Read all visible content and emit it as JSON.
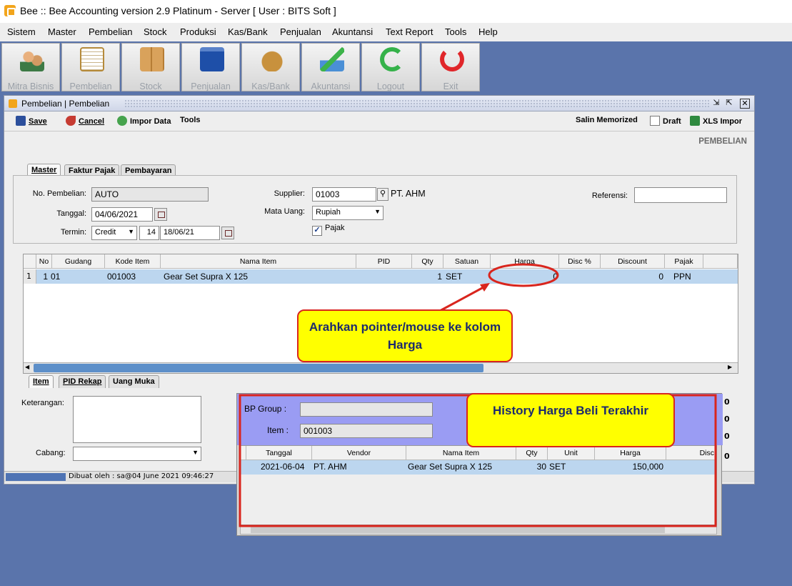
{
  "window_title": "Bee :: Bee Accounting version 2.9 Platinum - Server  [ User : BITS Soft ]",
  "menu": [
    "Sistem",
    "Master",
    "Pembelian",
    "Stock",
    "Produksi",
    "Kas/Bank",
    "Penjualan",
    "Akuntansi",
    "Text Report",
    "Tools",
    "Help"
  ],
  "toolbar": [
    {
      "label": "Mitra Bisnis",
      "icon": "people-icon"
    },
    {
      "label": "Pembelian",
      "icon": "invoice-icon"
    },
    {
      "label": "Stock",
      "icon": "boxes-icon"
    },
    {
      "label": "Penjualan",
      "icon": "shopping-bag-icon"
    },
    {
      "label": "Kas/Bank",
      "icon": "money-bag-icon"
    },
    {
      "label": "Akuntansi",
      "icon": "chart-up-icon"
    },
    {
      "label": "Logout",
      "icon": "logout-arrow-icon"
    },
    {
      "label": "Exit",
      "icon": "power-icon"
    }
  ],
  "inner_window": {
    "title": "Pembelian | Pembelian"
  },
  "form_toolbar": {
    "save": "Save",
    "cancel": "Cancel",
    "import": "Impor Data",
    "tools": "Tools",
    "salin": "Salin Memorized",
    "draft": "Draft",
    "xls": "XLS Impor"
  },
  "section_label": "PEMBELIAN",
  "tabs_top": [
    "Master",
    "Faktur Pajak",
    "Pembayaran"
  ],
  "form": {
    "no_pembelian_label": "No. Pembelian:",
    "no_pembelian": "AUTO",
    "tanggal_label": "Tanggal:",
    "tanggal": "04/06/2021",
    "termin_label": "Termin:",
    "termin": "Credit",
    "termin_days": "14",
    "termin_date": "18/06/21",
    "supplier_label": "Supplier:",
    "supplier_code": "01003",
    "supplier_name": "PT. AHM",
    "mata_uang_label": "Mata Uang:",
    "mata_uang": "Rupiah",
    "pajak_label": "Pajak",
    "referensi_label": "Referensi:",
    "referensi": ""
  },
  "grid": {
    "headers": [
      "No",
      "Gudang",
      "Kode Item",
      "Nama Item",
      "PID",
      "Qty",
      "Satuan",
      "Harga",
      "Disc %",
      "Discount",
      "Pajak"
    ],
    "rows": [
      {
        "idx": "1",
        "no": "1",
        "gudang": "01",
        "kode": "001003",
        "nama": "Gear Set Supra X 125",
        "pid": "",
        "qty": "1",
        "satuan": "SET",
        "harga": "0",
        "disc": "",
        "discount": "0",
        "pajak": "PPN"
      }
    ]
  },
  "tabs_bottom": [
    "Item",
    "PID Rekap",
    "Uang Muka"
  ],
  "bottom": {
    "keterangan_label": "Keterangan:",
    "cabang_label": "Cabang:",
    "right_values": [
      "0",
      "0",
      "0",
      "0"
    ]
  },
  "status": "Dibuat oleh : sa@04 June 2021  09:46:27",
  "popup": {
    "bp_group_label": "BP Group :",
    "bp_group": "",
    "item_label": "Item :",
    "item": "001003",
    "headers": [
      "Tanggal",
      "Vendor",
      "Nama Item",
      "Qty",
      "Unit",
      "Harga",
      "Disc"
    ],
    "rows": [
      {
        "tanggal": "2021-06-04",
        "vendor": "PT. AHM",
        "nama": "Gear Set Supra X 125",
        "qty": "30",
        "unit": "SET",
        "harga": "150,000"
      }
    ]
  },
  "callouts": {
    "pointer": "Arahkan pointer/mouse ke kolom Harga",
    "history": "History Harga Beli Terakhir"
  },
  "colors": {
    "accent_red": "#d9251d",
    "callout_yellow": "#ffff00",
    "desktop": "#5a74ab",
    "selected_row": "#bcd6ef",
    "popup_header": "#9a9cf3"
  }
}
